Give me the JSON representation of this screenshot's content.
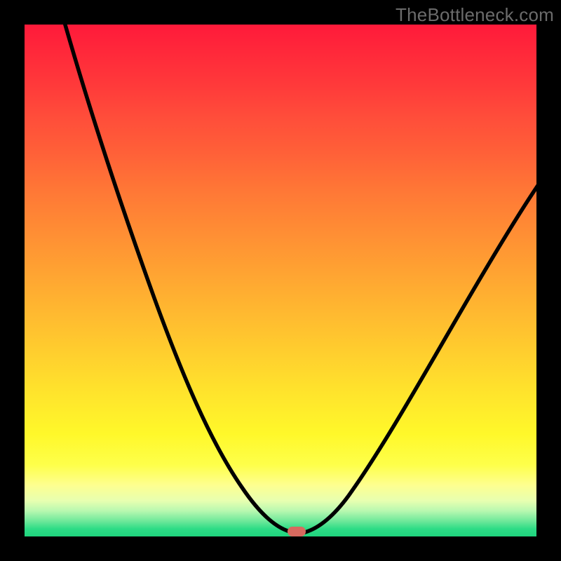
{
  "watermark": "TheBottleneck.com",
  "colors": {
    "frame_background": "#000000",
    "curve_stroke": "#000000",
    "marker_fill": "#d86a5f",
    "gradient_top": "#ff1a3a",
    "gradient_mid": "#ffe42c",
    "gradient_bottom": "#1fd47e",
    "watermark": "#6b6b6b"
  },
  "chart_data": {
    "type": "line",
    "title": "",
    "xlabel": "",
    "ylabel": "",
    "xlim": [
      0,
      100
    ],
    "ylim": [
      0,
      100
    ],
    "grid": false,
    "legend": false,
    "series": [
      {
        "name": "bottleneck-curve",
        "x": [
          8,
          12,
          18,
          25,
          32,
          38,
          44,
          48,
          52,
          53,
          55,
          58,
          63,
          70,
          78,
          86,
          94,
          100
        ],
        "values": [
          100,
          85,
          70,
          55,
          42,
          30,
          18,
          8,
          2,
          0,
          2,
          6,
          14,
          26,
          40,
          54,
          65,
          72
        ]
      }
    ],
    "annotations": [
      {
        "name": "minimum-marker",
        "shape": "rounded-rect",
        "x": 53,
        "y": 0,
        "color": "#d86a5f"
      }
    ],
    "background": {
      "style": "vertical-gradient",
      "stops": [
        {
          "pos": 0.0,
          "color": "#ff1a3a"
        },
        {
          "pos": 0.4,
          "color": "#ff8c34"
        },
        {
          "pos": 0.78,
          "color": "#fff82a"
        },
        {
          "pos": 0.9,
          "color": "#feff90"
        },
        {
          "pos": 1.0,
          "color": "#1fd47e"
        }
      ]
    }
  }
}
